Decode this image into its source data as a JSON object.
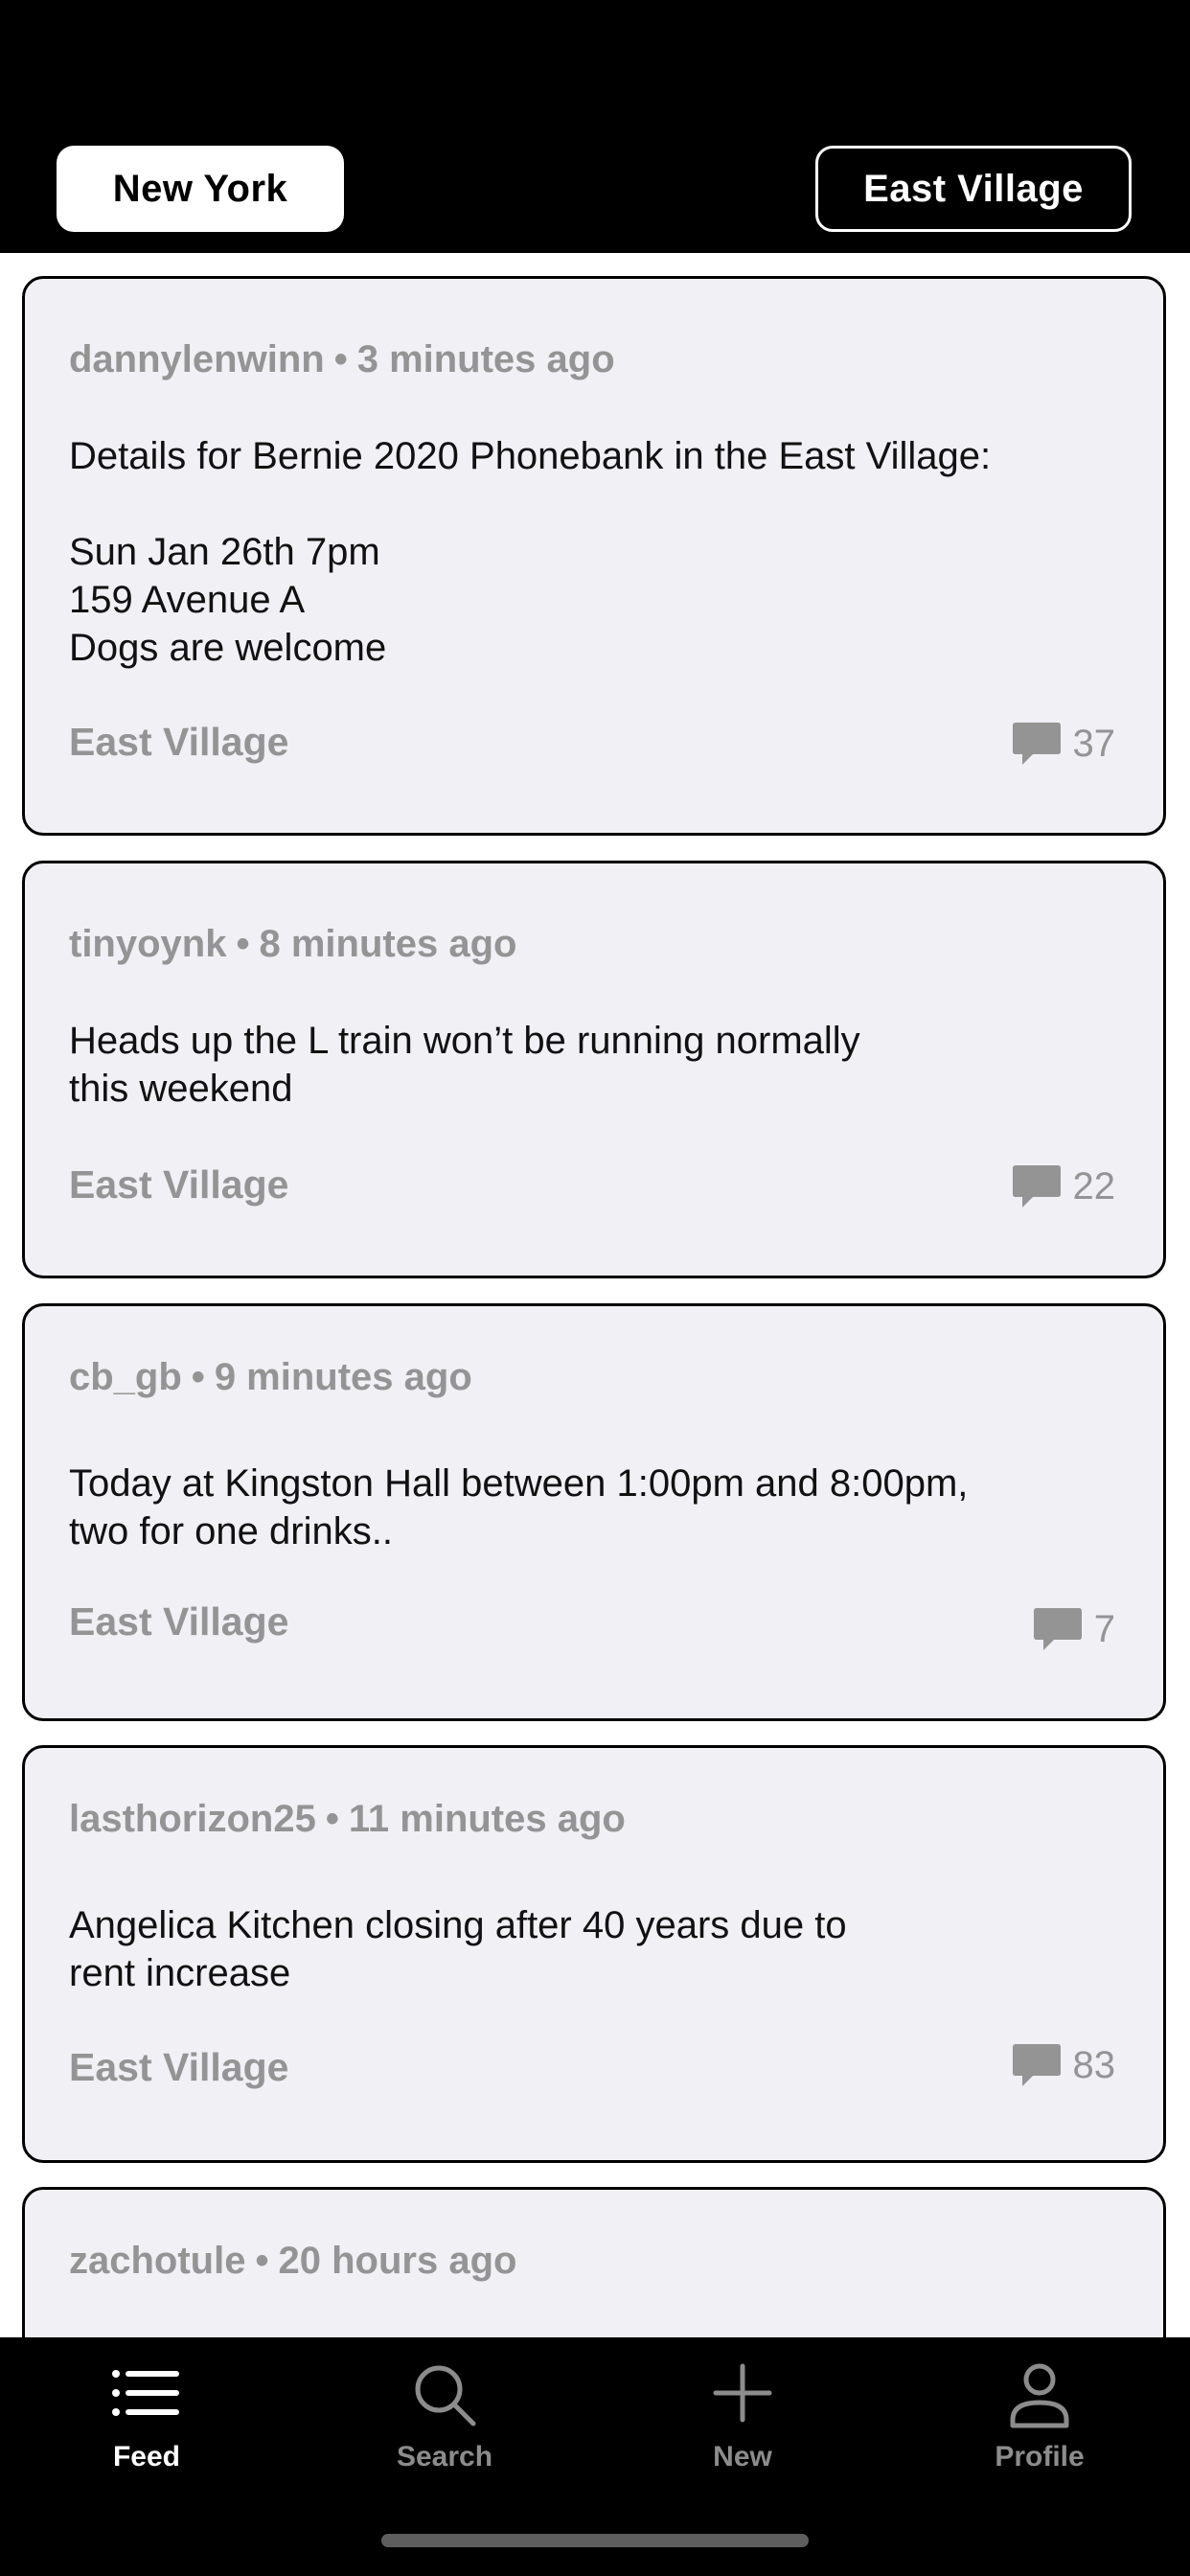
{
  "header": {
    "city": "New York",
    "neighborhood": "East Village"
  },
  "posts": [
    {
      "author": "dannylenwinn",
      "time": "3 minutes ago",
      "body": "Details for Bernie 2020 Phonebank in the East Village:\n\nSun Jan 26th 7pm\n159 Avenue A\nDogs are welcome",
      "location": "East Village",
      "comments": "37"
    },
    {
      "author": "tinyoynk",
      "time": "8 minutes ago",
      "body": "Heads up the L train won’t be running normally\nthis weekend",
      "location": "East Village",
      "comments": "22"
    },
    {
      "author": "cb_gb",
      "time": "9 minutes ago",
      "body": "Today at Kingston Hall between 1:00pm and 8:00pm,\ntwo for one drinks..",
      "location": "East Village",
      "comments": "7"
    },
    {
      "author": "lasthorizon25",
      "time": "11 minutes ago",
      "body": "Angelica Kitchen closing after 40 years due to\nrent increase",
      "location": "East Village",
      "comments": "83"
    },
    {
      "author": "zachotule",
      "time": "20 hours ago"
    }
  ],
  "separator": "•",
  "tabs": [
    {
      "label": "Feed",
      "icon": "list-icon",
      "active": true
    },
    {
      "label": "Search",
      "icon": "search-icon",
      "active": false
    },
    {
      "label": "New",
      "icon": "plus-icon",
      "active": false
    },
    {
      "label": "Profile",
      "icon": "person-icon",
      "active": false
    }
  ],
  "colors": {
    "background": "#000000",
    "card": "#f0f0f5",
    "muted_text": "#949494",
    "active_tab": "#ffffff"
  }
}
